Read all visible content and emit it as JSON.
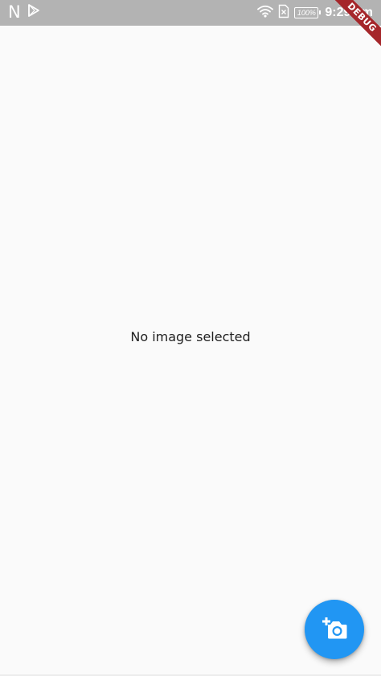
{
  "status_bar": {
    "clock": "9:29 am",
    "battery": "100%",
    "left_icons": [
      "n-icon",
      "play-store-icon"
    ],
    "right_icons": [
      "wifi-icon",
      "sim-absent-icon",
      "battery-icon"
    ],
    "background": "#b3b3b3"
  },
  "debug_banner": {
    "label": "DEBUG",
    "color": "#a5262a"
  },
  "main": {
    "empty_message": "No image selected",
    "background": "#fafafa"
  },
  "fab": {
    "icon": "add-a-photo-icon",
    "color": "#2196f3"
  }
}
